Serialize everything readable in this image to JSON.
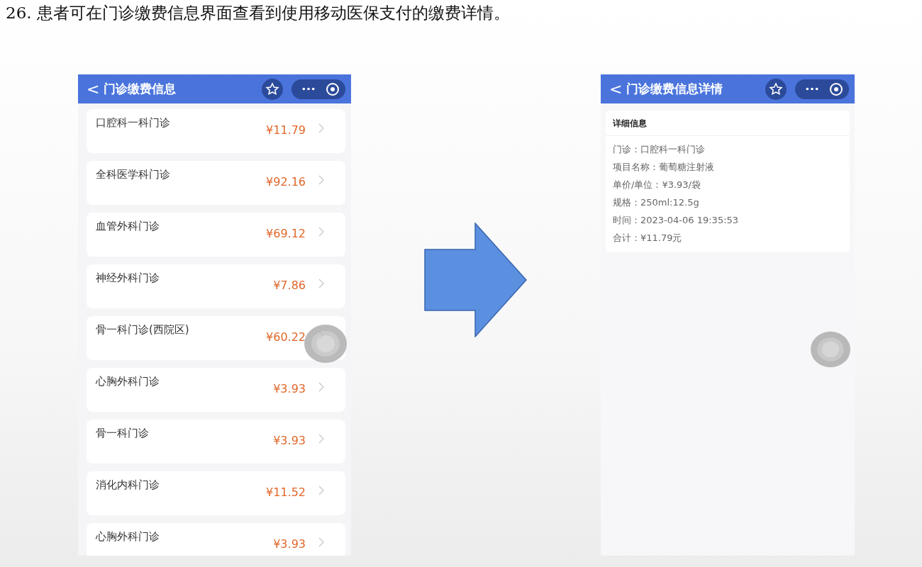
{
  "heading": "26. 患者可在门诊缴费信息界面查看到使用移动医保支付的缴费详情。",
  "list_screen": {
    "title": "门诊缴费信息",
    "back": "<",
    "items": [
      {
        "name": "口腔科一科门诊",
        "amount": "¥11.79"
      },
      {
        "name": "全科医学科门诊",
        "amount": "¥92.16"
      },
      {
        "name": "血管外科门诊",
        "amount": "¥69.12"
      },
      {
        "name": "神经外科门诊",
        "amount": "¥7.86"
      },
      {
        "name": "骨一科门诊(西院区)",
        "amount": "¥60.22"
      },
      {
        "name": "心胸外科门诊",
        "amount": "¥3.93"
      },
      {
        "name": "骨一科门诊",
        "amount": "¥3.93"
      },
      {
        "name": "消化内科门诊",
        "amount": "¥11.52"
      },
      {
        "name": "心胸外科门诊",
        "amount": "¥3.93"
      }
    ]
  },
  "detail_screen": {
    "title": "门诊缴费信息详情",
    "back": "<",
    "card_title": "详细信息",
    "fields": [
      "门诊：口腔科一科门诊",
      "项目名称：葡萄糖注射液",
      "单价/单位：¥3.93/袋",
      "规格：250ml:12.5g",
      "时间：2023-04-06 19:35:53",
      "合计：¥11.79元"
    ]
  }
}
